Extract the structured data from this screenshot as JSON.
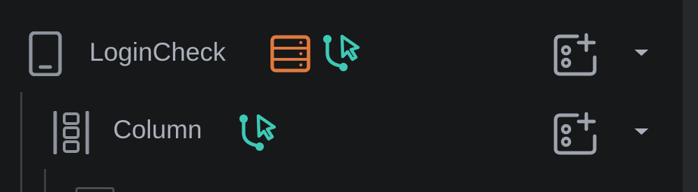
{
  "tree": {
    "items": [
      {
        "label": "LoginCheck",
        "type_icon": "mobile-device-icon",
        "badges": [
          "database-icon",
          "flow-cursor-icon"
        ],
        "action_icon": "add-widget-icon",
        "menu_icon": "chevron-down-icon"
      },
      {
        "label": "Column",
        "type_icon": "column-layout-icon",
        "badges": [
          "flow-cursor-icon"
        ],
        "action_icon": "add-widget-icon",
        "menu_icon": "chevron-down-icon"
      }
    ]
  },
  "colors": {
    "background": "#17181a",
    "text": "#aab0ba",
    "icon_gray": "#8e949d",
    "database_orange": "#e07a3e",
    "flow_teal": "#3ec9b6",
    "guide_line": "#3a3d42",
    "scrollbar": "#26282c"
  }
}
